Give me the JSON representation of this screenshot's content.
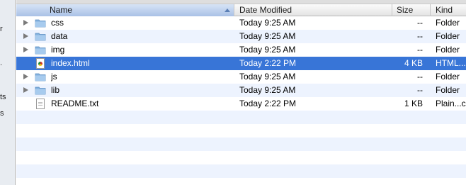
{
  "sidebar_fragments": [
    "r",
    ".",
    "ts",
    "s"
  ],
  "columns": {
    "name": "Name",
    "date": "Date Modified",
    "size": "Size",
    "kind": "Kind"
  },
  "files": [
    {
      "name": "css",
      "date": "Today 9:25 AM",
      "size": "--",
      "kind": "Folder",
      "icon": "folder-icon"
    },
    {
      "name": "data",
      "date": "Today 9:25 AM",
      "size": "--",
      "kind": "Folder",
      "icon": "folder-icon"
    },
    {
      "name": "img",
      "date": "Today 9:25 AM",
      "size": "--",
      "kind": "Folder",
      "icon": "folder-icon"
    },
    {
      "name": "index.html",
      "date": "Today 2:22 PM",
      "size": "4 KB",
      "kind": "HTML...",
      "icon": "html-file-icon",
      "selected": true
    },
    {
      "name": "js",
      "date": "Today 9:25 AM",
      "size": "--",
      "kind": "Folder",
      "icon": "folder-icon"
    },
    {
      "name": "lib",
      "date": "Today 9:25 AM",
      "size": "--",
      "kind": "Folder",
      "icon": "folder-icon"
    },
    {
      "name": "README.txt",
      "date": "Today 2:22 PM",
      "size": "1 KB",
      "kind": "Plain...c",
      "icon": "text-file-icon"
    }
  ],
  "colors": {
    "selection": "#3875d7",
    "alt_row": "#edf3fe",
    "sort_header": "#a9c1e6"
  }
}
